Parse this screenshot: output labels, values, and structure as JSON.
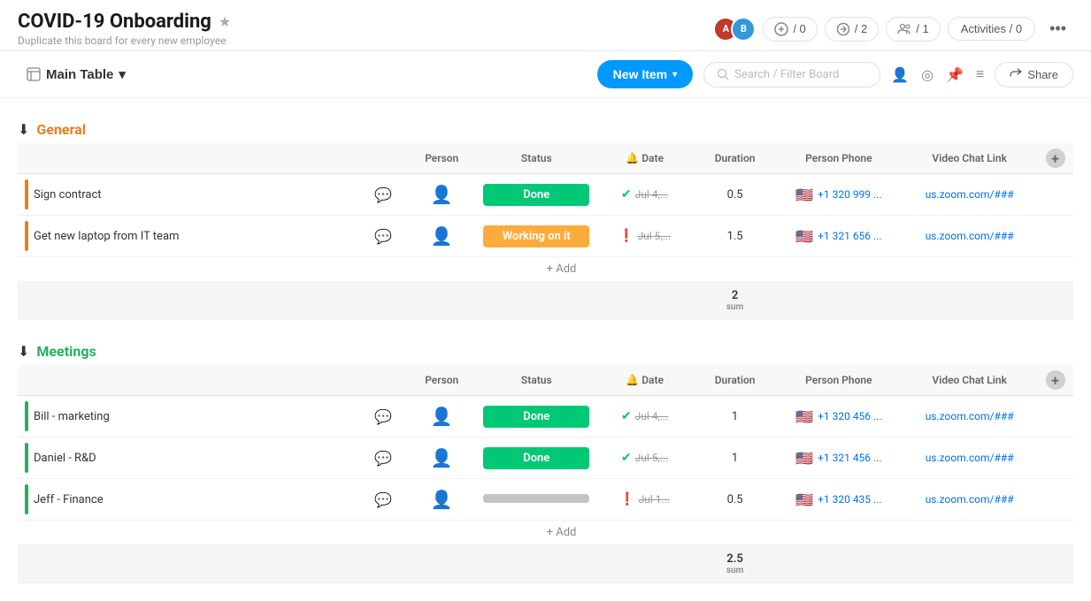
{
  "header": {
    "title": "COVID-19 Onboarding",
    "subtitle": "Duplicate this board for every new employee",
    "star_label": "★",
    "avatars": [
      {
        "initials": "A",
        "color": "#c0392b"
      },
      {
        "initials": "B",
        "color": "#3498db"
      }
    ],
    "invite_count": "/ 0",
    "connect_count": "/ 2",
    "people_count": "/ 1",
    "activities_label": "Activities / 0",
    "more_icon": "•••"
  },
  "toolbar": {
    "main_table_label": "Main Table",
    "new_item_label": "New Item",
    "search_placeholder": "Search / Filter Board",
    "share_label": "Share"
  },
  "groups": [
    {
      "id": "general",
      "name": "General",
      "color": "#e67e22",
      "color_class": "orange",
      "bar_color": "#e67e22",
      "columns": {
        "person": "Person",
        "status": "Status",
        "date": "Date",
        "duration": "Duration",
        "person_phone": "Person Phone",
        "video_chat_link": "Video Chat Link"
      },
      "rows": [
        {
          "name": "Sign contract",
          "status": "Done",
          "status_class": "status-done",
          "date": "Jul 4,...",
          "date_icon": "check",
          "duration": "0.5",
          "phone": "+1 320 999 ...",
          "video": "us.zoom.com/###"
        },
        {
          "name": "Get new laptop from IT team",
          "status": "Working on it",
          "status_class": "status-working",
          "date": "Jul 5,...",
          "date_icon": "alert",
          "duration": "1.5",
          "phone": "+1 321 656 ...",
          "video": "us.zoom.com/###"
        }
      ],
      "add_row_label": "+ Add",
      "sum_value": "2",
      "sum_label": "sum"
    },
    {
      "id": "meetings",
      "name": "Meetings",
      "color": "#27ae60",
      "color_class": "green",
      "bar_color": "#27ae60",
      "columns": {
        "person": "Person",
        "status": "Status",
        "date": "Date",
        "duration": "Duration",
        "person_phone": "Person Phone",
        "video_chat_link": "Video Chat Link"
      },
      "rows": [
        {
          "name": "Bill - marketing",
          "status": "Done",
          "status_class": "status-done",
          "date": "Jul 4,...",
          "date_icon": "check",
          "duration": "1",
          "phone": "+1 320 456 ...",
          "video": "us.zoom.com/###"
        },
        {
          "name": "Daniel - R&D",
          "status": "Done",
          "status_class": "status-done",
          "date": "Jul 5,...",
          "date_icon": "check",
          "duration": "1",
          "phone": "+1 321 456 ...",
          "video": "us.zoom.com/###"
        },
        {
          "name": "Jeff - Finance",
          "status": "",
          "status_class": "status-empty",
          "date": "Jul 1...",
          "date_icon": "alert",
          "duration": "0.5",
          "phone": "+1 320 435 ...",
          "video": "us.zoom.com/###"
        }
      ],
      "add_row_label": "+ Add",
      "sum_value": "2.5",
      "sum_label": "sum"
    }
  ]
}
